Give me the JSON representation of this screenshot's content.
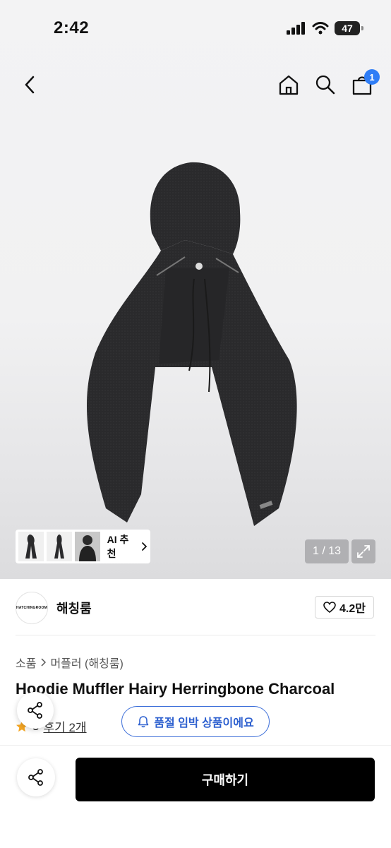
{
  "status_bar": {
    "time": "2:42",
    "battery": "47"
  },
  "nav": {
    "cart_count": "1"
  },
  "gallery": {
    "ai_label": "AI 추천",
    "counter": "1 / 13"
  },
  "store": {
    "logo_text": "HATCHINGROOM",
    "name": "해칭룸",
    "likes": "4.2만"
  },
  "breadcrumb": {
    "level1": "소품",
    "level2": "머플러 (해칭룸)"
  },
  "product": {
    "title": "Hoodie Muffler Hairy Herringbone Charcoal",
    "rating": "5",
    "reviews": "후기 2개"
  },
  "stock_notice": "품절 임박 상품이에요",
  "buy_label": "구매하기",
  "colors": {
    "accent_blue": "#2f7df6",
    "buy_bg": "#000000"
  }
}
